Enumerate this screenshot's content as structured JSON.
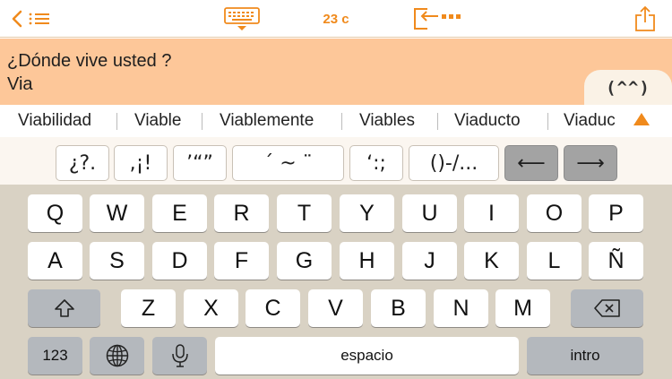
{
  "toolbar": {
    "count": "23 c"
  },
  "text": {
    "line1": "¿Dónde vive usted ?",
    "line2": "Via",
    "emoticon": "(^^)"
  },
  "suggestions": [
    "Viabilidad",
    "Viable",
    "Viablemente",
    "Viables",
    "Viaducto",
    "Viaduc"
  ],
  "punctuation": {
    "k1": "¿?.",
    "k2": ",¡!",
    "k3": "’“”",
    "k4": "´ ~ ¨",
    "k5": "‘:;",
    "k6": "()-/...",
    "left": "⟵",
    "right": "⟶"
  },
  "keyboard": {
    "row1": [
      "Q",
      "W",
      "E",
      "R",
      "T",
      "Y",
      "U",
      "I",
      "O",
      "P"
    ],
    "row2": [
      "A",
      "S",
      "D",
      "F",
      "G",
      "H",
      "J",
      "K",
      "L",
      "Ñ"
    ],
    "row3": [
      "Z",
      "X",
      "C",
      "V",
      "B",
      "N",
      "M"
    ],
    "numbers_label": "123",
    "space_label": "espacio",
    "return_label": "intro"
  },
  "colors": {
    "accent": "#f08a1c",
    "text_area": "#fdc799",
    "keyboard_bg": "#d9d2c4"
  }
}
